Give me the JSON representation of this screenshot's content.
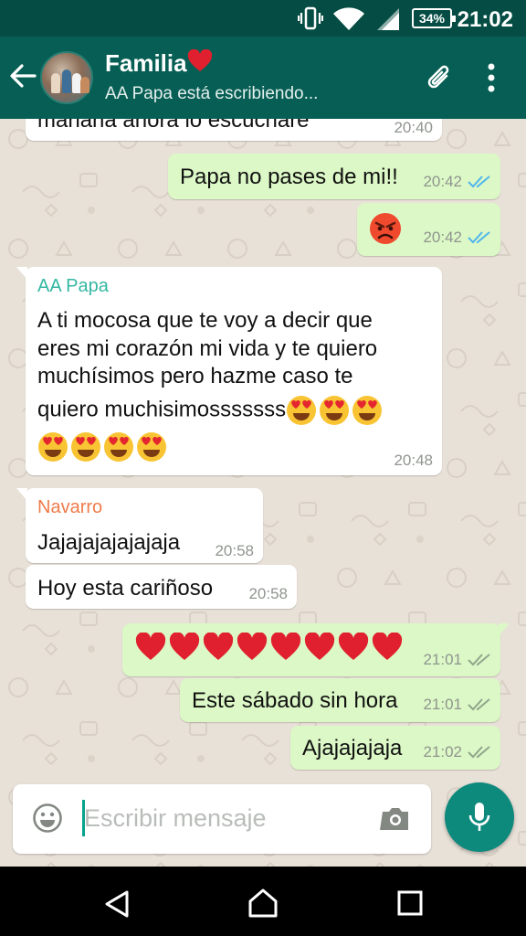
{
  "status_bar": {
    "battery": "34%",
    "time": "21:02",
    "icons": [
      "vibrate-icon",
      "wifi-icon",
      "signal-icon",
      "battery-icon"
    ]
  },
  "header": {
    "title": "Familia",
    "title_emoji": "red-heart",
    "subtitle": "AA Papa está escribiendo...",
    "icons": [
      "back-arrow-icon",
      "avatar",
      "attach-clip-icon",
      "overflow-menu-icon"
    ]
  },
  "messages": [
    {
      "direction": "in",
      "text": "mañana ahora lo escucharé",
      "time": "20:40"
    },
    {
      "direction": "out",
      "text": "Papa no pases de mi!!",
      "time": "20:42",
      "status": "read"
    },
    {
      "direction": "out",
      "emoji": [
        "angry-face"
      ],
      "time": "20:42",
      "status": "read"
    },
    {
      "direction": "in",
      "sender": "AA Papa",
      "sender_color": "#35b7a3",
      "lines": [
        "A ti mocosa que te voy a decir que",
        "eres mi corazón mi vida y te quiero",
        "muchísimos pero hazme caso te",
        "quiero muchisimosssssss"
      ],
      "emoji_count": 7,
      "emoji": "heart-eyes-face",
      "time": "20:48"
    },
    {
      "direction": "in",
      "sender": "Navarro",
      "sender_color": "#ef7b4a",
      "text": "Jajajajajajajaja",
      "time": "20:58"
    },
    {
      "direction": "in",
      "text": "Hoy esta cariñoso",
      "time": "20:58"
    },
    {
      "direction": "out",
      "emoji_count": 8,
      "emoji": "red-heart",
      "time": "21:01",
      "status": "delivered"
    },
    {
      "direction": "out",
      "text": "Este sábado sin hora",
      "time": "21:01",
      "status": "delivered"
    },
    {
      "direction": "out",
      "text": "Ajajajajaja",
      "time": "21:02",
      "status": "delivered"
    }
  ],
  "input": {
    "placeholder": "Escribir mensaje",
    "value": ""
  },
  "colors": {
    "app_bar": "#075e54",
    "status_bar": "#054d44",
    "outgoing_bubble": "#dcf8c6",
    "incoming_bubble": "#ffffff",
    "read_tick": "#4fb6ec",
    "delivered_tick": "#92a58c",
    "mic_button": "#0d8a7c"
  }
}
